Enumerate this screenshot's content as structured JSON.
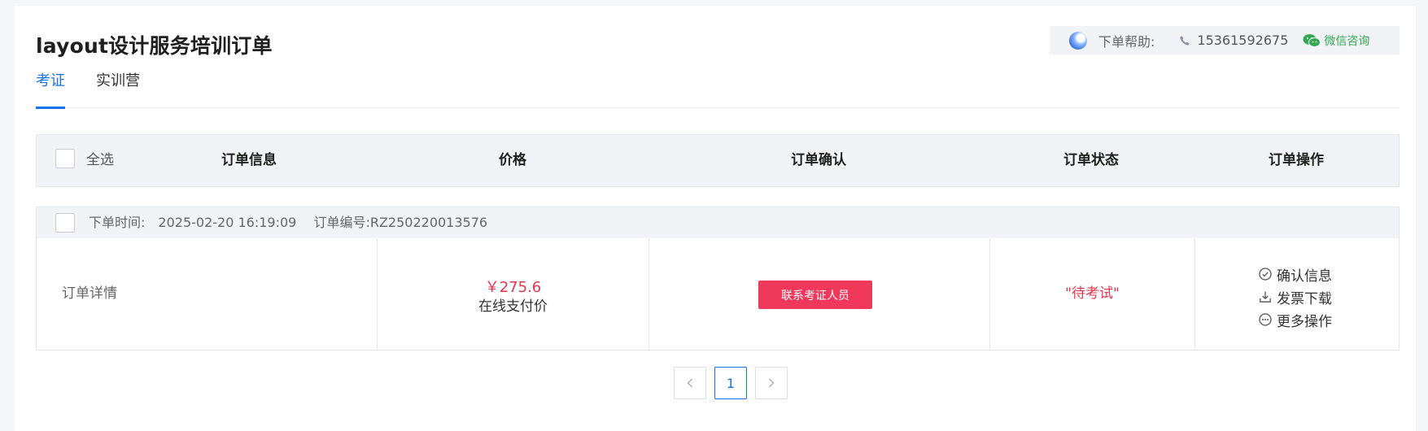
{
  "page": {
    "title": "layout设计服务培训订单"
  },
  "help": {
    "label": "下单帮助:",
    "phone": "15361592675",
    "wechat": "微信咨询",
    "icons": [
      "help-logo-icon",
      "phone-icon",
      "wechat-icon"
    ]
  },
  "tabs": [
    {
      "label": "考证",
      "active": true
    },
    {
      "label": "实训营",
      "active": false
    }
  ],
  "table": {
    "select_all": "全选",
    "headers": [
      "订单信息",
      "价格",
      "订单确认",
      "订单状态",
      "订单操作"
    ]
  },
  "order": {
    "time_label": "下单时间:",
    "time": "2025-02-20 16:19:09",
    "no_label": "订单编号:",
    "no": "RZ250220013576",
    "detail": "订单详情",
    "price": "￥275.6",
    "price_note": "在线支付价",
    "confirm_button": "联系考证人员",
    "status": "\"待考试\"",
    "actions": [
      {
        "label": "确认信息",
        "icon": "check-circle-icon"
      },
      {
        "label": "发票下载",
        "icon": "download-icon"
      },
      {
        "label": "更多操作",
        "icon": "more-circle-icon"
      }
    ]
  },
  "pagination": {
    "prev": "<",
    "current": "1",
    "next": ">"
  },
  "colors": {
    "accent": "#1a73e8",
    "danger": "#e8344e",
    "button": "#f0385a",
    "wechat": "#35a853",
    "header_bg": "#f1f3f6"
  }
}
